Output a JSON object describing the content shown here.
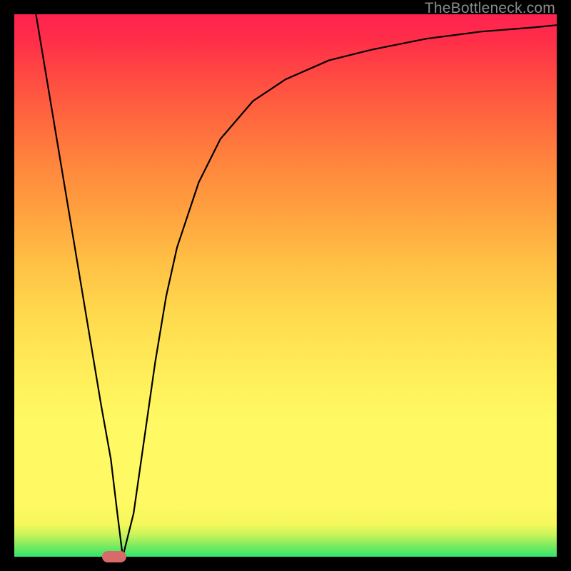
{
  "watermark": "TheBottleneck.com",
  "colors": {
    "frame": "#000000",
    "marker": "#d86a6a",
    "curve": "#000000"
  },
  "chart_data": {
    "type": "line",
    "title": "",
    "xlabel": "",
    "ylabel": "",
    "xlim": [
      0,
      100
    ],
    "ylim": [
      0,
      100
    ],
    "grid": false,
    "legend": false,
    "note": "Axes are unlabeled in the source image; x/y values are estimated normalized percentages read from the plotted curve.",
    "series": [
      {
        "name": "curve",
        "x": [
          4,
          6,
          8,
          10,
          12,
          14,
          16,
          17.8,
          19,
          20,
          22,
          24,
          26,
          28,
          30,
          34,
          38,
          44,
          50,
          58,
          66,
          76,
          86,
          96,
          100
        ],
        "y": [
          100,
          88,
          76,
          64,
          52,
          40,
          28,
          18,
          8,
          0,
          8,
          22,
          36,
          48,
          57,
          69,
          77,
          84,
          88,
          91.5,
          93.5,
          95.5,
          96.8,
          97.6,
          98
        ]
      }
    ],
    "marker": {
      "x": 18.4,
      "y": 0
    }
  }
}
